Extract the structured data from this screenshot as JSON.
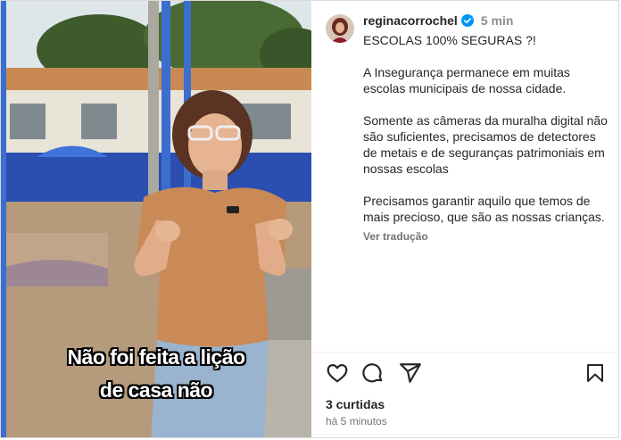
{
  "video": {
    "subtitle_line1": "Não foi feita a lição",
    "subtitle_line2": "de casa não"
  },
  "post": {
    "username": "reginacorrochel",
    "time": "5 min",
    "caption": "ESCOLAS 100% SEGURAS ?!\n\nA Insegurança permanece em muitas escolas municipais de nossa cidade.\n\nSomente as câmeras da muralha digital não são suficientes, precisamos de detectores de metais e de seguranças patrimoniais em nossas escolas\n\nPrecisamos garantir aquilo que temos de mais precioso, que são as nossas crianças.",
    "translate_label": "Ver tradução",
    "likes": "3 curtidas",
    "posted_ago": "há 5 minutos"
  },
  "colors": {
    "verified": "#0095f6",
    "blouse": "#c98a58",
    "fence": "#2f66c9"
  },
  "icons": [
    "heart-icon",
    "comment-icon",
    "share-icon",
    "bookmark-icon",
    "verified-badge-icon"
  ]
}
